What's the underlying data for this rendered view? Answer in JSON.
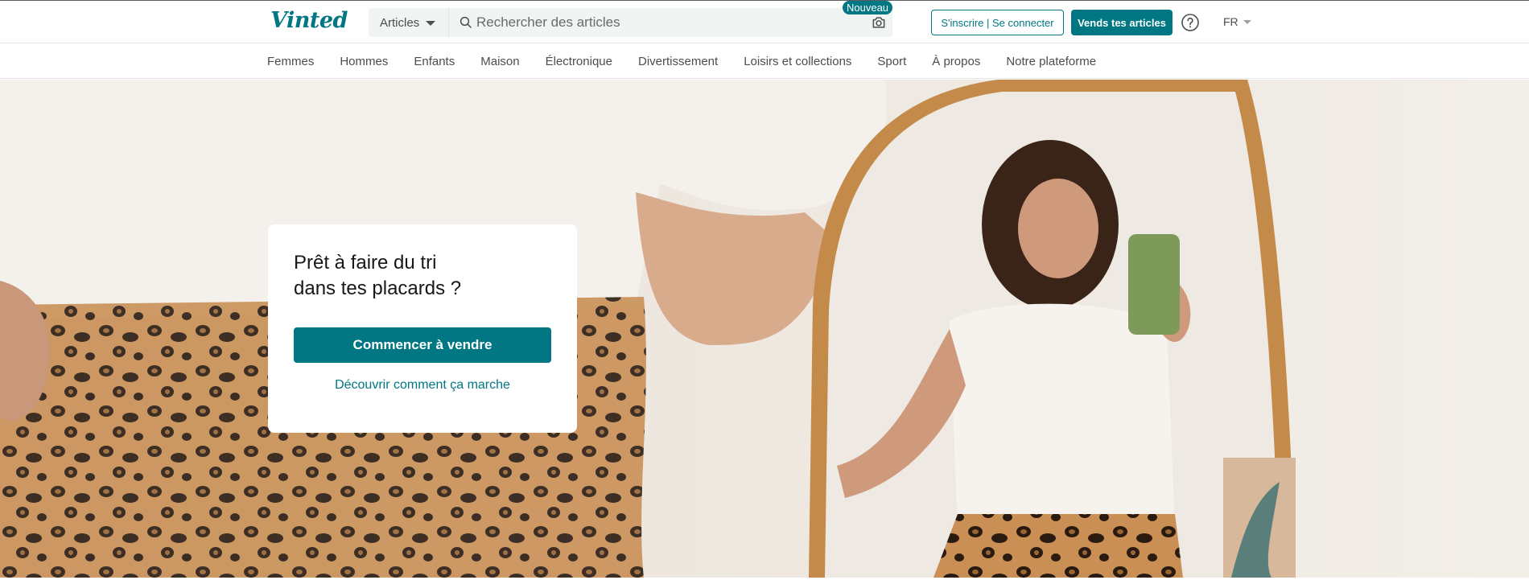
{
  "header": {
    "logo": "Vinted",
    "search": {
      "category_label": "Articles",
      "placeholder": "Rechercher des articles",
      "badge": "Nouveau"
    },
    "login_label": "S'inscrire | Se connecter",
    "sell_label": "Vends tes articles",
    "language": "FR"
  },
  "nav": {
    "items": [
      "Femmes",
      "Hommes",
      "Enfants",
      "Maison",
      "Électronique",
      "Divertissement",
      "Loisirs et collections",
      "Sport",
      "À propos",
      "Notre plateforme"
    ]
  },
  "hero": {
    "title": "Prêt à faire du tri\ndans tes placards ?",
    "cta_label": "Commencer à vendre",
    "link_label": "Découvrir comment ça marche"
  },
  "colors": {
    "brand": "#007782",
    "text": "#171717",
    "muted": "#4d4d4d",
    "search_bg": "#f0f4f3"
  },
  "icons": [
    "search-icon",
    "camera-icon",
    "question-circle-icon",
    "chevron-down-icon"
  ]
}
